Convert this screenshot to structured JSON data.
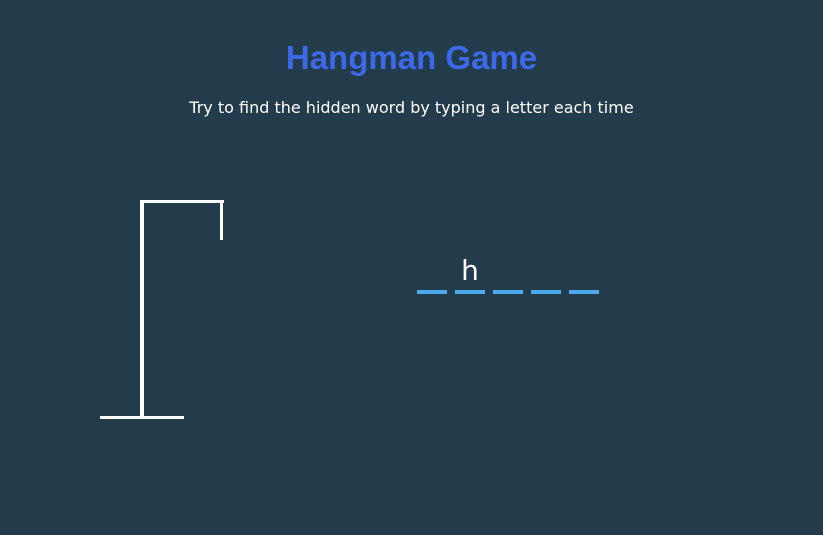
{
  "header": {
    "title": "Hangman Game",
    "subtitle": "Try to find the hidden word by typing a letter each time"
  },
  "word": {
    "slots": [
      "",
      "h",
      "",
      "",
      ""
    ]
  },
  "figure": {
    "wrong_guesses_shown": 0
  },
  "colors": {
    "background": "#233c4b",
    "title": "#3d68e8",
    "text": "#ffffff",
    "underline": "#4ea8ec",
    "gallows": "#ffffff"
  }
}
